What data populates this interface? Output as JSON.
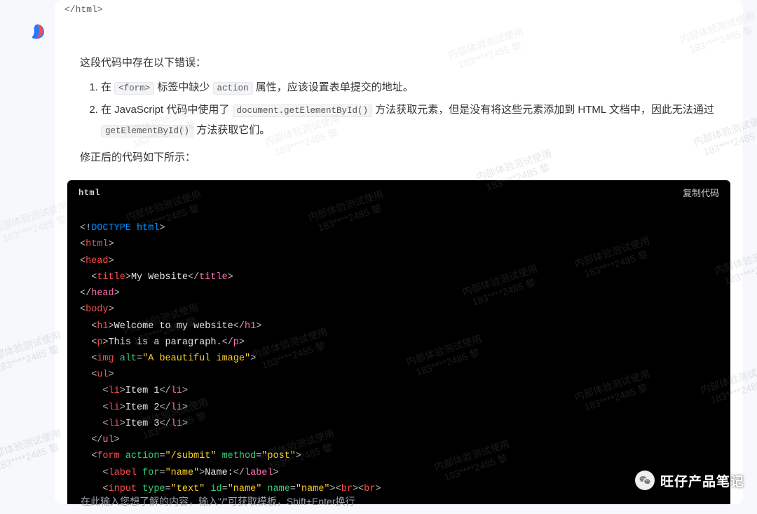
{
  "closing_tag": "</html>",
  "intro": "这段代码中存在以下错误：",
  "errors": {
    "e1_a": "在 ",
    "e1_code1": "<form>",
    "e1_b": " 标签中缺少 ",
    "e1_code2": "action",
    "e1_c": " 属性，应该设置表单提交的地址。",
    "e2_a": "在 JavaScript 代码中使用了 ",
    "e2_code1": "document.getElementById()",
    "e2_b": " 方法获取元素，但是没有将这些元素添加到 HTML 文档中，因此无法通过 ",
    "e2_code2": "getElementById()",
    "e2_c": " 方法获取它们。"
  },
  "corrected_intro": "修正后的代码如下所示：",
  "code_header_lang": "html",
  "copy_label": "复制代码",
  "code": {
    "doctype_open": "<!",
    "doctype_kw": "DOCTYPE html",
    "doctype_close": ">",
    "title_text": "My Website",
    "h1_text": "Welcome to my website",
    "p_text": "This is a paragraph.",
    "img_alt_val": "\"A beautiful image\"",
    "li1": "Item 1",
    "li2": "Item 2",
    "li3": "Item 3",
    "form_action_val": "\"/submit\"",
    "form_method_val": "\"post\"",
    "label_for_val": "\"name\"",
    "label_text": "Name:",
    "input_type_val": "\"text\"",
    "input_id_val": "\"name\"",
    "input_name_val": "\"name\""
  },
  "watermark_line1": "内部体验测试使用",
  "watermark_line2": "183****2485 黎",
  "input_placeholder": "在此输入您想了解的内容，输入\"/\"可获取模板，Shift+Enter换行",
  "channel_name": "旺仔产品笔记"
}
